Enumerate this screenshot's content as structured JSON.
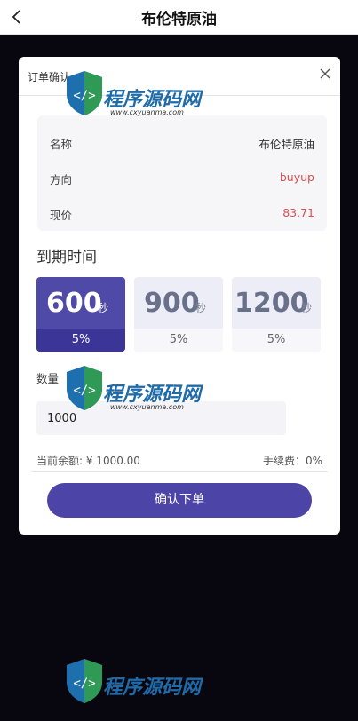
{
  "header": {
    "title": "布伦特原油",
    "back_icon": "back-chevron-icon"
  },
  "modal": {
    "title": "订单确认",
    "close_icon": "close-icon",
    "info": {
      "name_label": "名称",
      "name_value": "布伦特原油",
      "direction_label": "方向",
      "direction_value": "buyup",
      "price_label": "现价",
      "price_value": "83.71"
    },
    "expire": {
      "label": "到期时间",
      "options": [
        {
          "seconds": "600",
          "unit": "秒",
          "rate": "5%",
          "selected": true
        },
        {
          "seconds": "900",
          "unit": "秒",
          "rate": "5%",
          "selected": false
        },
        {
          "seconds": "1200",
          "unit": "秒",
          "rate": "5%",
          "selected": false
        }
      ]
    },
    "quantity": {
      "label": "数量",
      "value": "1000"
    },
    "balance_text": "当前余额: ¥ 1000.00",
    "fee_text": "手续费：0%",
    "confirm_label": "确认下单"
  },
  "watermark": {
    "text": "程序源码网",
    "sub": "www.cxyuanma.com"
  },
  "colors": {
    "accent": "#4d44a7",
    "red": "#d94f4f",
    "background": "#08070f"
  }
}
